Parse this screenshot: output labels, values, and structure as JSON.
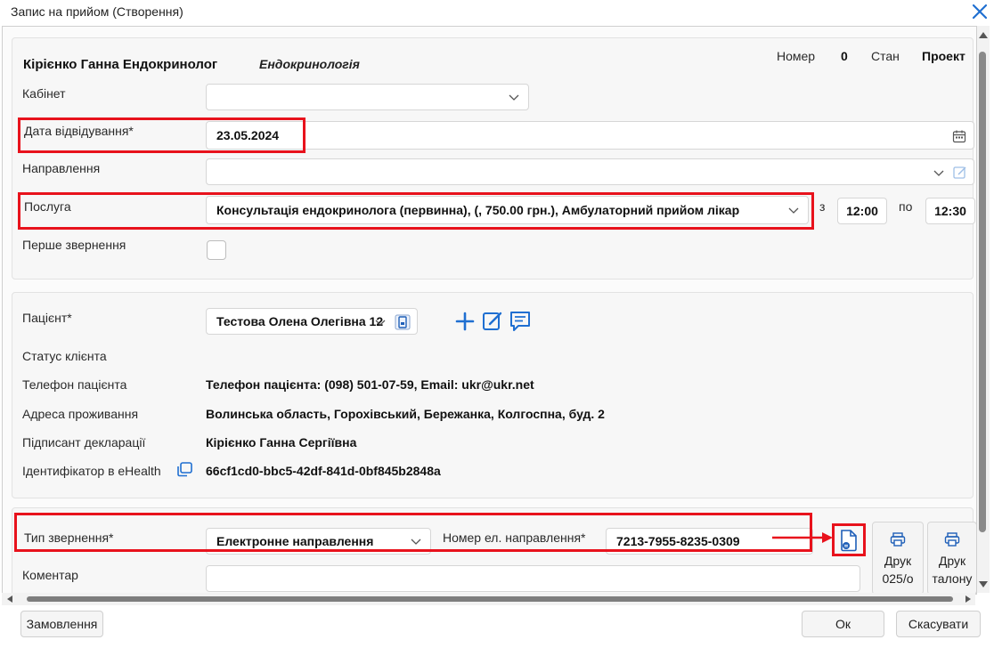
{
  "window": {
    "title": "Запис на прийом (Створення)"
  },
  "header": {
    "doctor_name": "Кірієнко Ганна Ендокринолог",
    "specialty": "Ендокринологія",
    "number_label": "Номер",
    "number_value": "0",
    "state_label": "Стан",
    "state_value": "Проект"
  },
  "form": {
    "cabinet_label": "Кабінет",
    "cabinet_value": "",
    "visit_date_label": "Дата відвідування*",
    "visit_date_value": "23.05.2024",
    "referral_label": "Направлення",
    "referral_value": "",
    "service_label": "Послуга",
    "service_value": "Консультація ендокринолога (первинна), (, 750.00 грн.), Амбулаторний прийом лікар",
    "time_from_label": "з",
    "time_from_value": "12:00",
    "time_to_label": "по",
    "time_to_value": "12:30",
    "first_visit_label": "Перше звернення"
  },
  "patient": {
    "patient_label": "Пацієнт*",
    "patient_value": "Тестова Олена Олегівна 12",
    "client_status_label": "Статус клієнта",
    "phone_label": "Телефон пацієнта",
    "phone_value": "Телефон пацієнта: (098) 501-07-59, Email: ukr@ukr.net",
    "address_label": "Адреса проживання",
    "address_value": "Волинська область, Горохівський, Бережанка, Колгоспна, буд. 2",
    "signer_label": "Підписант декларації",
    "signer_value": "Кірієнко Ганна Сергіївна",
    "ehealth_label": "Ідентифікатор в eHealth",
    "ehealth_value": "66cf1cd0-bbc5-42df-841d-0bf845b2848a"
  },
  "appeal": {
    "type_label": "Тип звернення*",
    "type_value": "Електронне направлення",
    "ref_number_label": "Номер ел. направлення*",
    "ref_number_value": "7213-7955-8235-0309",
    "print_025_line1": "Друк",
    "print_025_line2": "025/о",
    "print_ticket_line1": "Друк",
    "print_ticket_line2": "талону",
    "comment_label": "Коментар",
    "comment_value": ""
  },
  "footer": {
    "order_label": "Замовлення",
    "ok_label": "Ок",
    "cancel_label": "Скасувати"
  },
  "colors": {
    "accent": "#1f6fd1",
    "highlight": "#e8121c"
  }
}
